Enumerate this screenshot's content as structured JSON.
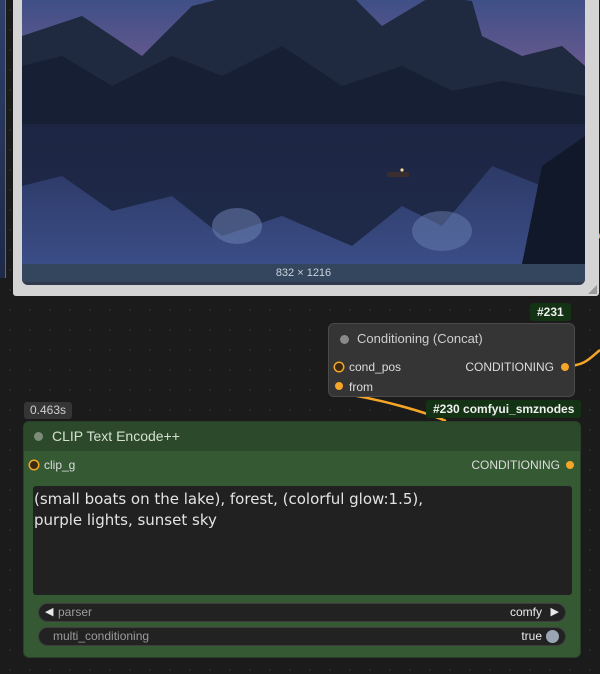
{
  "preview": {
    "dimensions": "832 × 1216"
  },
  "node_concat": {
    "id_badge": "#231",
    "title": "Conditioning (Concat)",
    "inputs": [
      "cond_pos",
      "from"
    ],
    "output": "CONDITIONING"
  },
  "node_clip": {
    "timing": "0.463s",
    "id_badge": "#230 comfyui_smznodes",
    "title": "CLIP Text Encode++",
    "input": "clip_g",
    "output": "CONDITIONING",
    "prompt": "(small boats on the lake), forest, (colorful glow:1.5),\npurple lights, sunset sky",
    "parser": {
      "label": "parser",
      "value": "comfy"
    },
    "multi_conditioning": {
      "label": "multi_conditioning",
      "value": "true"
    }
  },
  "colors": {
    "link": "#f6a627",
    "clip_node_body": "#355a33",
    "badge_bg": "#143314"
  }
}
